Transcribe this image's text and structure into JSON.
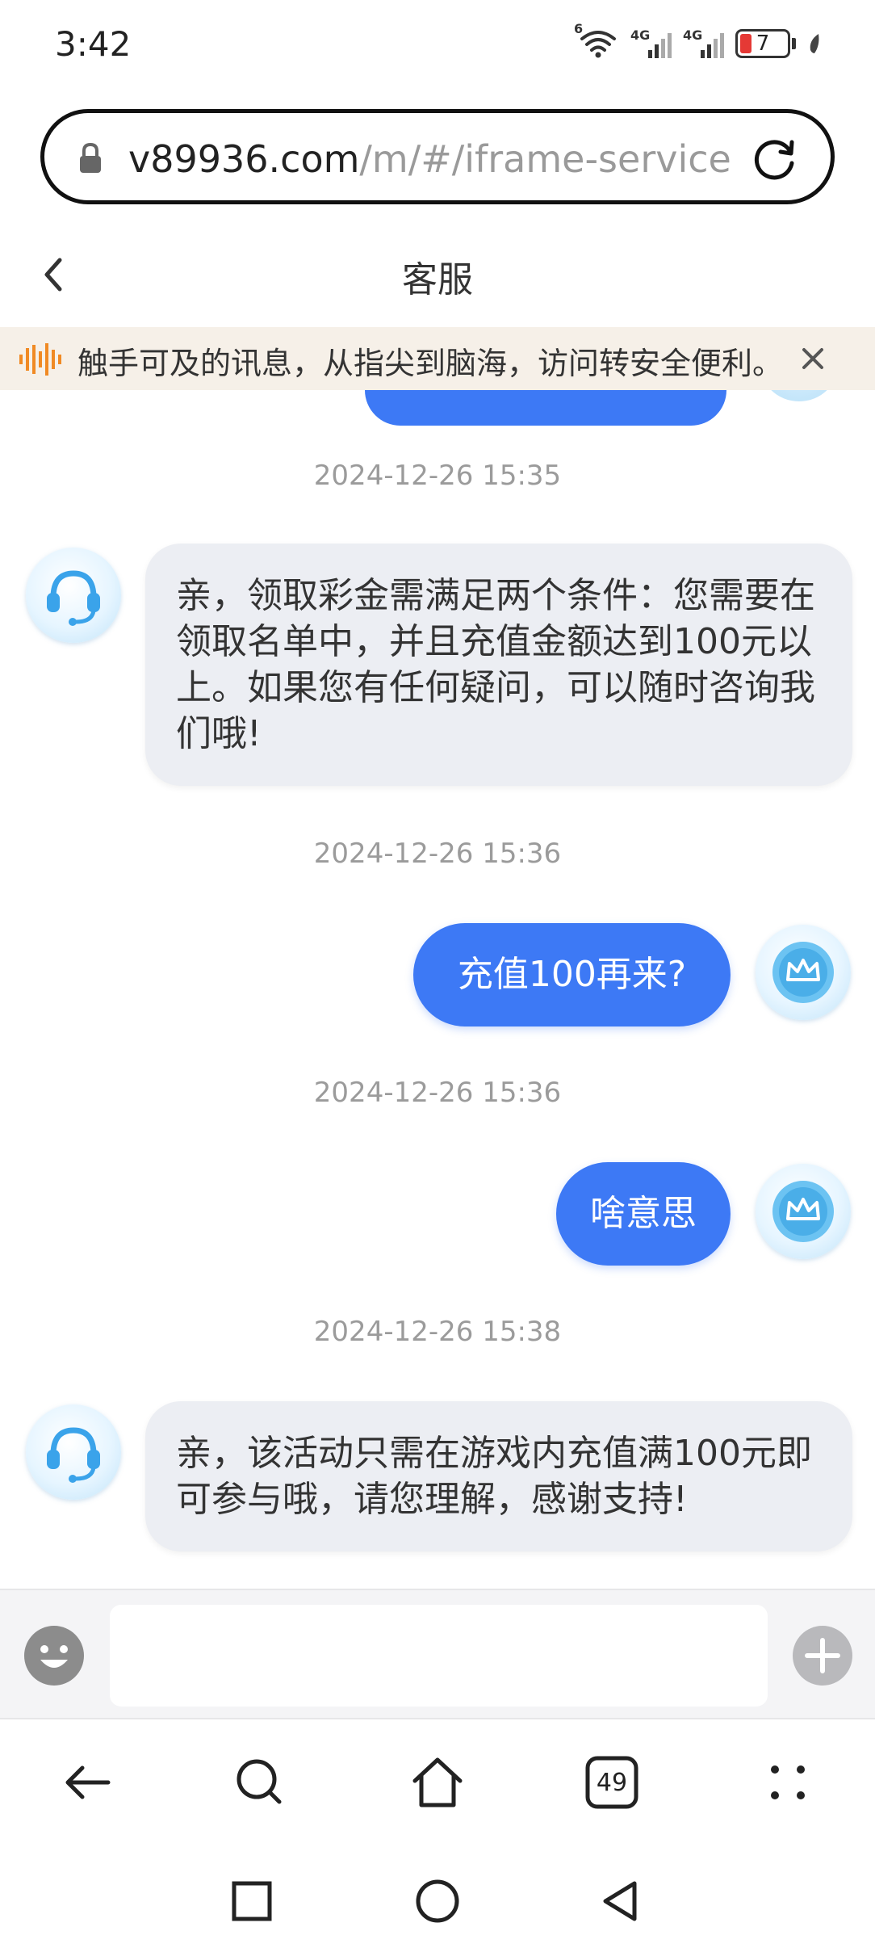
{
  "status_bar": {
    "time": "3:42",
    "wifi_badge": "6",
    "signal1_label": "4G",
    "signal2_label": "4G",
    "battery_level": "7",
    "icons": [
      "wifi-icon",
      "signal-4g-icon",
      "signal-4g-icon",
      "battery-icon",
      "leaf-icon"
    ]
  },
  "url_bar": {
    "host": "v89936.com",
    "path": "/m/#/iframe-service",
    "icons": [
      "lock-icon",
      "reload-icon"
    ]
  },
  "header": {
    "title": "客服",
    "back_icon": "chevron-left-icon"
  },
  "notice": {
    "text": "触手可及的讯息，从指尖到脑海，访问转安全便利。",
    "icon": "sound-wave-icon",
    "close_icon": "close-icon",
    "accent_color": "#f08a24"
  },
  "messages": [
    {
      "timestamp": "2024-12-26 15:35",
      "from": "agent",
      "text": "亲，领取彩金需满足两个条件：您需要在领取名单中，并且充值金额达到100元以上。如果您有任何疑问，可以随时咨询我们哦!"
    },
    {
      "timestamp": "2024-12-26 15:36",
      "from": "user",
      "text": "充值100再来?"
    },
    {
      "timestamp": "2024-12-26 15:36",
      "from": "user",
      "text": "啥意思"
    },
    {
      "timestamp": "2024-12-26 15:38",
      "from": "agent",
      "text": "亲，该活动只需在游戏内充值满100元即可参与哦，请您理解，感谢支持!"
    }
  ],
  "composer": {
    "input_value": "",
    "input_placeholder": "",
    "emoji_icon": "emoji-icon",
    "plus_icon": "plus-icon"
  },
  "browser_nav": {
    "tab_count": "49",
    "icons": [
      "back-arrow-icon",
      "search-icon",
      "home-icon",
      "tabs-icon",
      "more-icon"
    ]
  },
  "system_nav": {
    "icons": [
      "recents-icon",
      "home-circle-icon",
      "back-triangle-icon"
    ]
  },
  "colors": {
    "user_bubble": "#3d79f5",
    "agent_bubble": "#eceef3",
    "timestamp": "#9b9b9b",
    "notice_bg": "#f6f0e8"
  }
}
